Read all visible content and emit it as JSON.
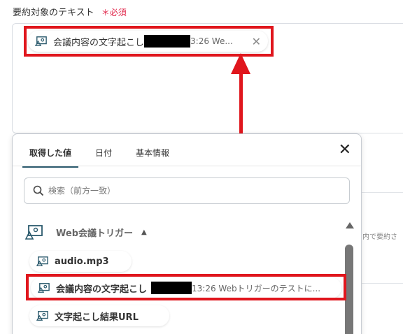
{
  "field": {
    "label": "要約対象のテキスト",
    "required_mark": "＊必須"
  },
  "selected_chip": {
    "text_before": "会議内容の文字起こし",
    "text_after": "3:26 We...",
    "remove_label": "✕"
  },
  "background": {
    "cut_text": "内で要約さ"
  },
  "picker": {
    "tabs": [
      {
        "label": "取得した値",
        "active": true
      },
      {
        "label": "日付",
        "active": false
      },
      {
        "label": "基本情報",
        "active": false
      }
    ],
    "close_label": "✕",
    "search_placeholder": "検索（前方一致）",
    "group": {
      "title": "Web会議トリガー",
      "chevron": "^"
    },
    "items": [
      {
        "label": "audio.mp3"
      },
      {
        "label": "会議内容の文字起こし",
        "suffix": "13:26 Webトリガーのテストに..."
      },
      {
        "label": "文字起こし結果URL"
      }
    ]
  },
  "colors": {
    "highlight": "#e0161d",
    "active_tab": "#2c5b6e",
    "required": "#e0264a"
  },
  "icons": [
    "meeting-icon",
    "search-icon",
    "close-icon",
    "chevron-up-icon",
    "arrow-up-icon"
  ]
}
